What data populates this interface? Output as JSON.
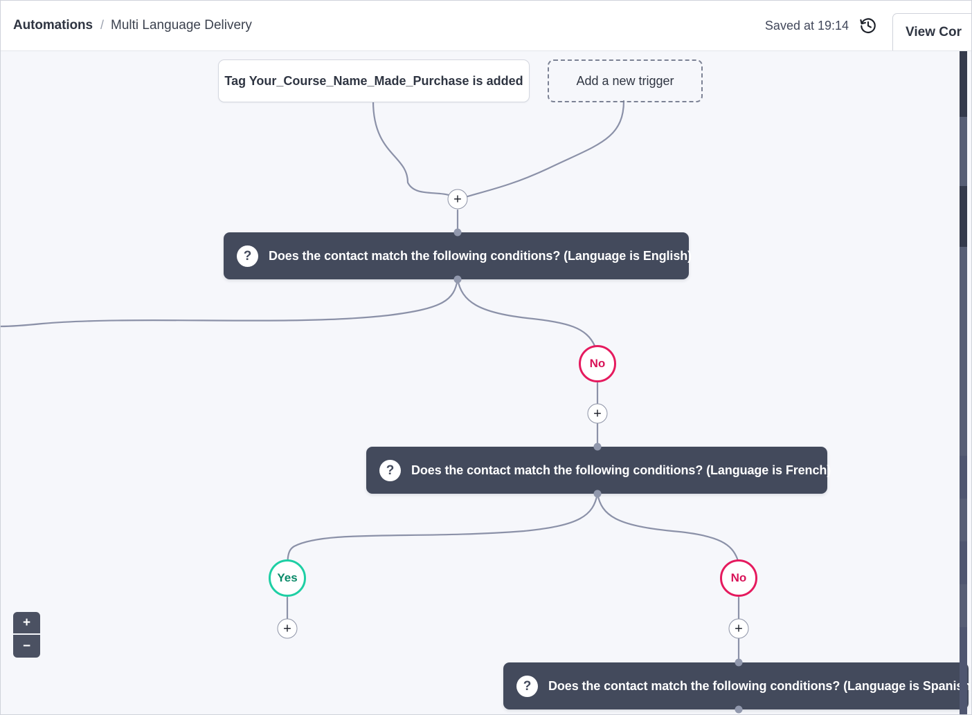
{
  "header": {
    "breadcrumb_root": "Automations",
    "breadcrumb_separator": "/",
    "breadcrumb_leaf": "Multi Language Delivery",
    "saved_status": "Saved at 19:14",
    "history_icon": "history-clock-icon",
    "view_button_label": "View Cor"
  },
  "canvas": {
    "background": "#f6f7fb",
    "edge_color": "#8b91a8",
    "triggers": [
      {
        "label": "Tag Your_Course_Name_Made_Purchase is added",
        "style": "solid"
      },
      {
        "label": "Add a new trigger",
        "style": "dashed"
      }
    ],
    "add_buttons": [
      {
        "label": "+",
        "name": "add-step-after-triggers"
      },
      {
        "label": "+",
        "name": "add-step-english-no"
      },
      {
        "label": "+",
        "name": "add-step-french-yes"
      },
      {
        "label": "+",
        "name": "add-step-french-no"
      }
    ],
    "conditions": [
      {
        "icon": "question-mark-icon",
        "label": "Does the contact match the following conditions? (Language is English)"
      },
      {
        "icon": "question-mark-icon",
        "label": "Does the contact match the following conditions? (Language is French)"
      },
      {
        "icon": "question-mark-icon",
        "label": "Does the contact match the following conditions? (Language is Spanish)"
      }
    ],
    "branches": [
      {
        "label": "No",
        "type": "no",
        "color": "#e51a5e"
      },
      {
        "label": "Yes",
        "type": "yes",
        "color": "#1ecfa4"
      },
      {
        "label": "No",
        "type": "no",
        "color": "#e51a5e"
      }
    ]
  },
  "zoom_control": {
    "zoom_in_label": "+",
    "zoom_out_label": "−"
  }
}
